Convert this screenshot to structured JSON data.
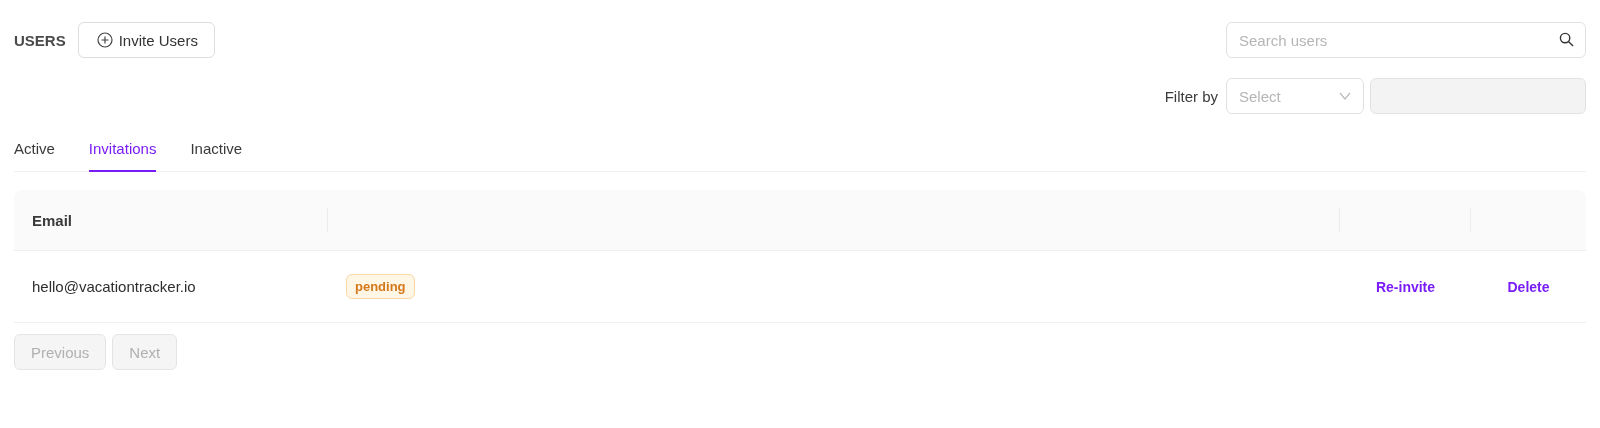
{
  "header": {
    "title": "USERS",
    "invite_button": "Invite Users"
  },
  "search": {
    "placeholder": "Search users"
  },
  "filter": {
    "label": "Filter by",
    "select": {
      "placeholder": "Select"
    },
    "value_field": {
      "disabled": true
    }
  },
  "tabs": [
    {
      "label": "Active",
      "selected": false
    },
    {
      "label": "Invitations",
      "selected": true
    },
    {
      "label": "Inactive",
      "selected": false
    }
  ],
  "table": {
    "columns": [
      {
        "label": "Email"
      }
    ],
    "rows": [
      {
        "email": "hello@vacationtracker.io",
        "status": "pending",
        "actions": [
          "Re-invite",
          "Delete"
        ]
      }
    ]
  },
  "pagination": [
    {
      "label": "Previous",
      "disabled": true
    },
    {
      "label": "Next",
      "disabled": true
    }
  ]
}
